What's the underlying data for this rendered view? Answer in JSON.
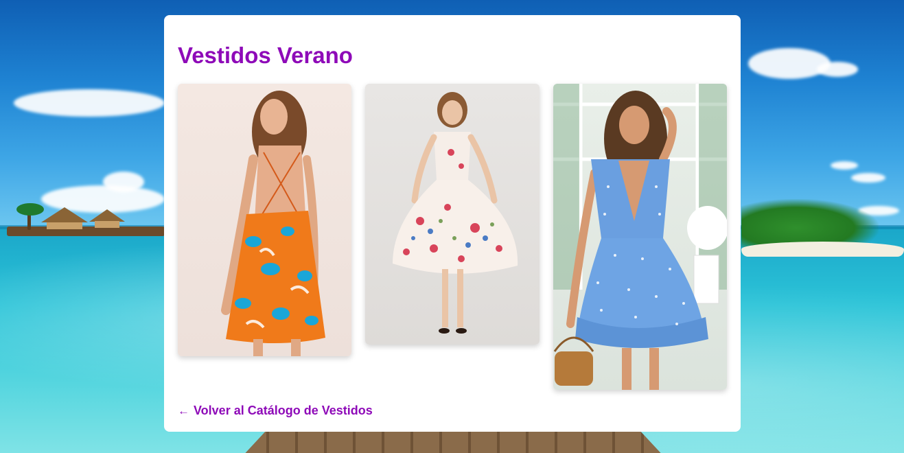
{
  "page": {
    "title": "Vestidos Verano",
    "accent_color": "#8e0ab8"
  },
  "gallery": {
    "images": [
      {
        "name": "vestido-naranja-floral-espalda-abierta"
      },
      {
        "name": "vestido-blanco-floral-midi"
      },
      {
        "name": "vestido-azul-lunares-volantes"
      }
    ]
  },
  "back_link": {
    "arrow_icon": "left-arrow-icon",
    "arrow": "←",
    "label": "Volver al Catálogo de Vestidos"
  }
}
